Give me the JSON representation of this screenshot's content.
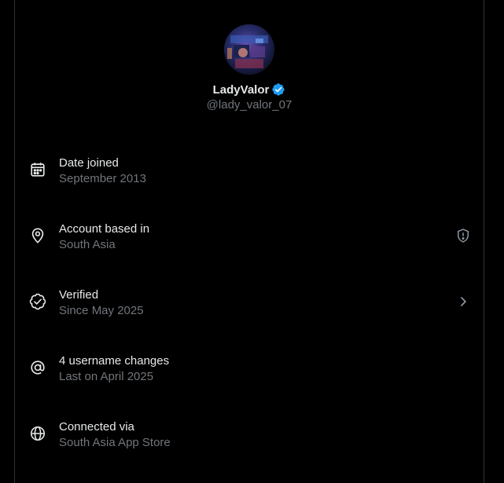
{
  "profile": {
    "display_name": "LadyValor",
    "handle": "@lady_valor_07",
    "verified_icon": "verified-badge-icon",
    "verified_color": "#1d9bf0"
  },
  "rows": [
    {
      "title": "Date joined",
      "subtitle": "September 2013",
      "icon": "calendar-icon"
    },
    {
      "title": "Account based in",
      "subtitle": "South Asia",
      "icon": "location-pin-icon",
      "trailing_icon": "shield-alert-icon"
    },
    {
      "title": "Verified",
      "subtitle": "Since May 2025",
      "icon": "verified-outline-icon",
      "trailing_icon": "chevron-right-icon"
    },
    {
      "title": "4 username changes",
      "subtitle": "Last on April 2025",
      "icon": "at-sign-icon"
    },
    {
      "title": "Connected via",
      "subtitle": "South Asia App Store",
      "icon": "globe-icon"
    }
  ],
  "colors": {
    "background": "#000000",
    "primary_text": "#e7e9ea",
    "secondary_text": "#71767b",
    "border": "#2f3336"
  }
}
